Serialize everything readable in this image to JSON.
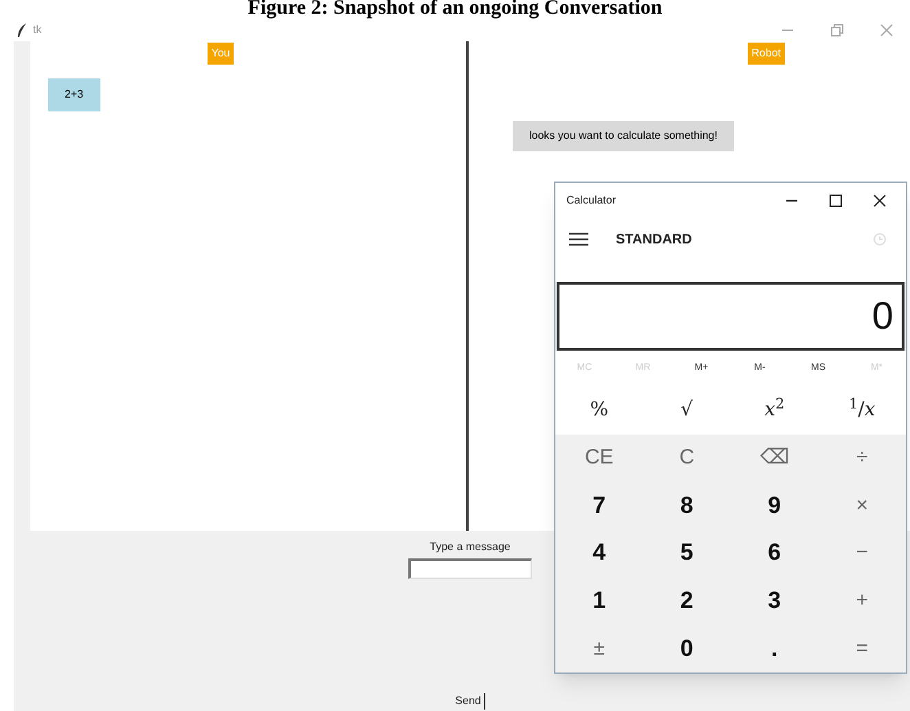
{
  "caption": "Figure 2: Snapshot of an ongoing Conversation",
  "window": {
    "title": "tk"
  },
  "chat": {
    "user_label": "You",
    "bot_label": "Robot",
    "user_messages": [
      "2+3"
    ],
    "bot_messages": [
      "looks you want to calculate something!"
    ]
  },
  "input": {
    "label": "Type a message"
  },
  "send_button": "Send",
  "calculator": {
    "title": "Calculator",
    "mode": "STANDARD",
    "display": "0",
    "memory": [
      {
        "label": "MC",
        "disabled": true
      },
      {
        "label": "MR",
        "disabled": true
      },
      {
        "label": "M+",
        "disabled": false
      },
      {
        "label": "M-",
        "disabled": false
      },
      {
        "label": "MS",
        "disabled": false
      },
      {
        "label": "M*",
        "disabled": true
      }
    ],
    "keys": [
      {
        "label": "%",
        "kind": "fn"
      },
      {
        "label": "√",
        "kind": "fn"
      },
      {
        "label": "*x*$^{2}$",
        "kind": "fn"
      },
      {
        "label": "$^{1}$/*x*",
        "kind": "fn"
      },
      {
        "label": "CE",
        "kind": "op"
      },
      {
        "label": "C",
        "kind": "op"
      },
      {
        "label": "⌫",
        "kind": "op"
      },
      {
        "label": "÷",
        "kind": "op"
      },
      {
        "label": "7",
        "kind": "digit"
      },
      {
        "label": "8",
        "kind": "digit"
      },
      {
        "label": "9",
        "kind": "digit"
      },
      {
        "label": "×",
        "kind": "op"
      },
      {
        "label": "4",
        "kind": "digit"
      },
      {
        "label": "5",
        "kind": "digit"
      },
      {
        "label": "6",
        "kind": "digit"
      },
      {
        "label": "−",
        "kind": "op"
      },
      {
        "label": "1",
        "kind": "digit"
      },
      {
        "label": "2",
        "kind": "digit"
      },
      {
        "label": "3",
        "kind": "digit"
      },
      {
        "label": "+",
        "kind": "op"
      },
      {
        "label": "±",
        "kind": "op"
      },
      {
        "label": "0",
        "kind": "digit"
      },
      {
        "label": ".",
        "kind": "digit"
      },
      {
        "label": "=",
        "kind": "op"
      }
    ]
  }
}
